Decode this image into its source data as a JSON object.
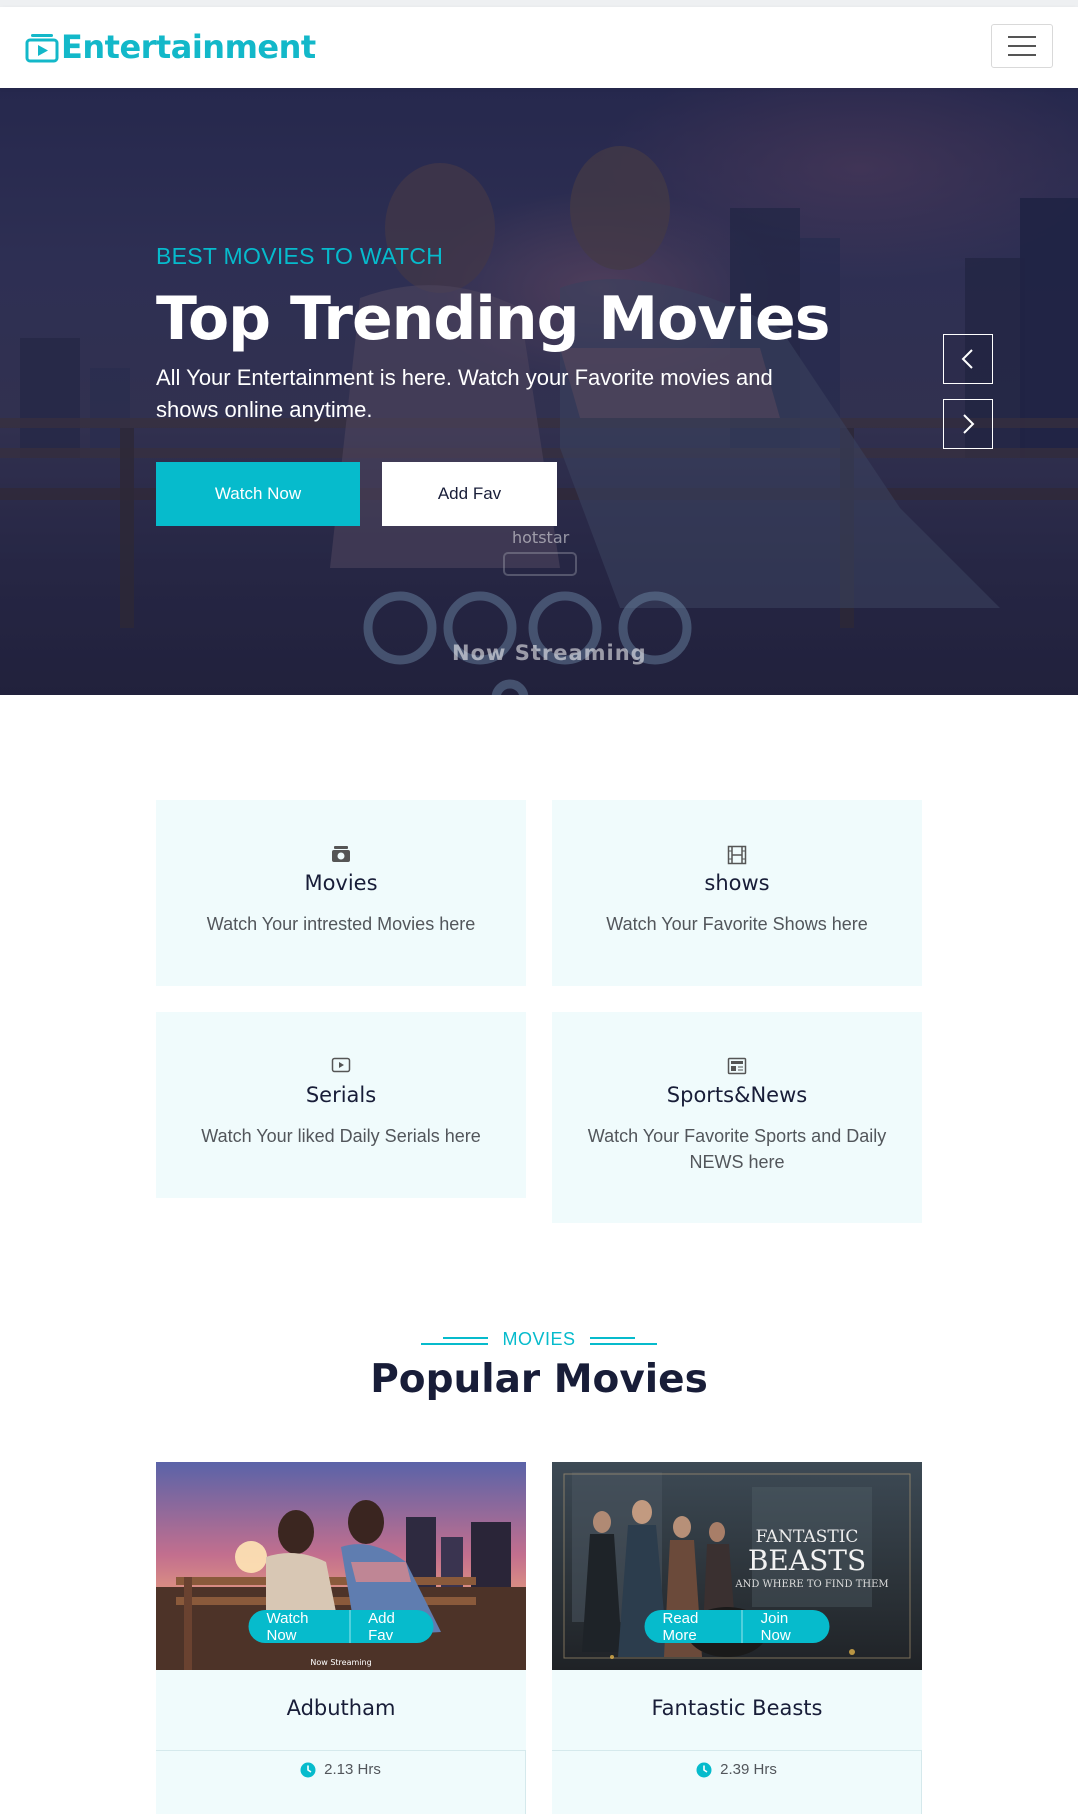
{
  "navbar": {
    "brand": "Entertainment",
    "brand_icon": "tv-play-icon",
    "toggler_icon": "hamburger-menu-icon",
    "accent_color": "#06bbcc"
  },
  "hero": {
    "kicker": "BEST MOVIES TO WATCH",
    "title": "Top Trending Movies",
    "description": "All Your Entertainment is here. Watch your Favorite movies and shows online anytime.",
    "primary_button": "Watch Now",
    "secondary_button": "Add Fav",
    "poster_text": "Now Streaming",
    "poster_logo_text": "hotstar",
    "prev_icon": "chevron-left-icon",
    "next_icon": "chevron-right-icon"
  },
  "services": [
    {
      "icon": "camera-video-icon",
      "title": "Movies",
      "text": "Watch Your intrested Movies here"
    },
    {
      "icon": "film-icon",
      "title": "shows",
      "text": "Watch Your Favorite Shows here"
    },
    {
      "icon": "play-btn-icon",
      "title": "Serials",
      "text": "Watch Your liked Daily Serials here"
    },
    {
      "icon": "newspaper-icon",
      "title": "Sports&News",
      "text": "Watch Your Favorite Sports and Daily NEWS here"
    }
  ],
  "movies_section": {
    "kicker": "MOVIES",
    "title": "Popular Movies"
  },
  "movies": [
    {
      "name": "Adbutham",
      "duration": "2.13 Hrs",
      "btn1": "Watch Now",
      "btn2": "Add Fav",
      "poster_text": "Now Streaming"
    },
    {
      "name": "Fantastic Beasts",
      "duration": "2.39 Hrs",
      "btn1": "Read More",
      "btn2": "Join Now",
      "poster_title": "FANTASTIC BEASTS",
      "poster_subtitle": "AND WHERE TO FIND THEM"
    }
  ]
}
